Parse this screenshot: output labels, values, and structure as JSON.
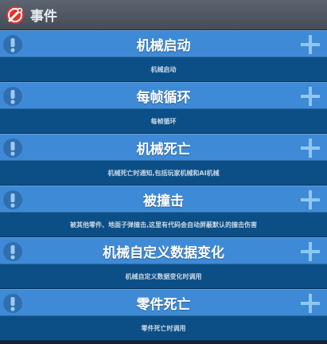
{
  "header": {
    "title": "事件",
    "icon": "wrench-icon"
  },
  "colors": {
    "bar": "#3f8ad6",
    "description": "#0c4f86",
    "add": "#8ec8f4"
  },
  "events": [
    {
      "title": "机械启动",
      "description": "机械启动"
    },
    {
      "title": "每帧循环",
      "description": "每帧循环"
    },
    {
      "title": "机械死亡",
      "description": "机械死亡时通知,包括玩家机械和AI机械"
    },
    {
      "title": "被撞击",
      "description": "被其他零件、地面子弹撞击,这里有代码会自动屏蔽默认的撞击伤害"
    },
    {
      "title": "机械自定义数据变化",
      "description": "机械自定义数据变化时调用"
    },
    {
      "title": "零件死亡",
      "description": "零件死亡时调用"
    }
  ]
}
